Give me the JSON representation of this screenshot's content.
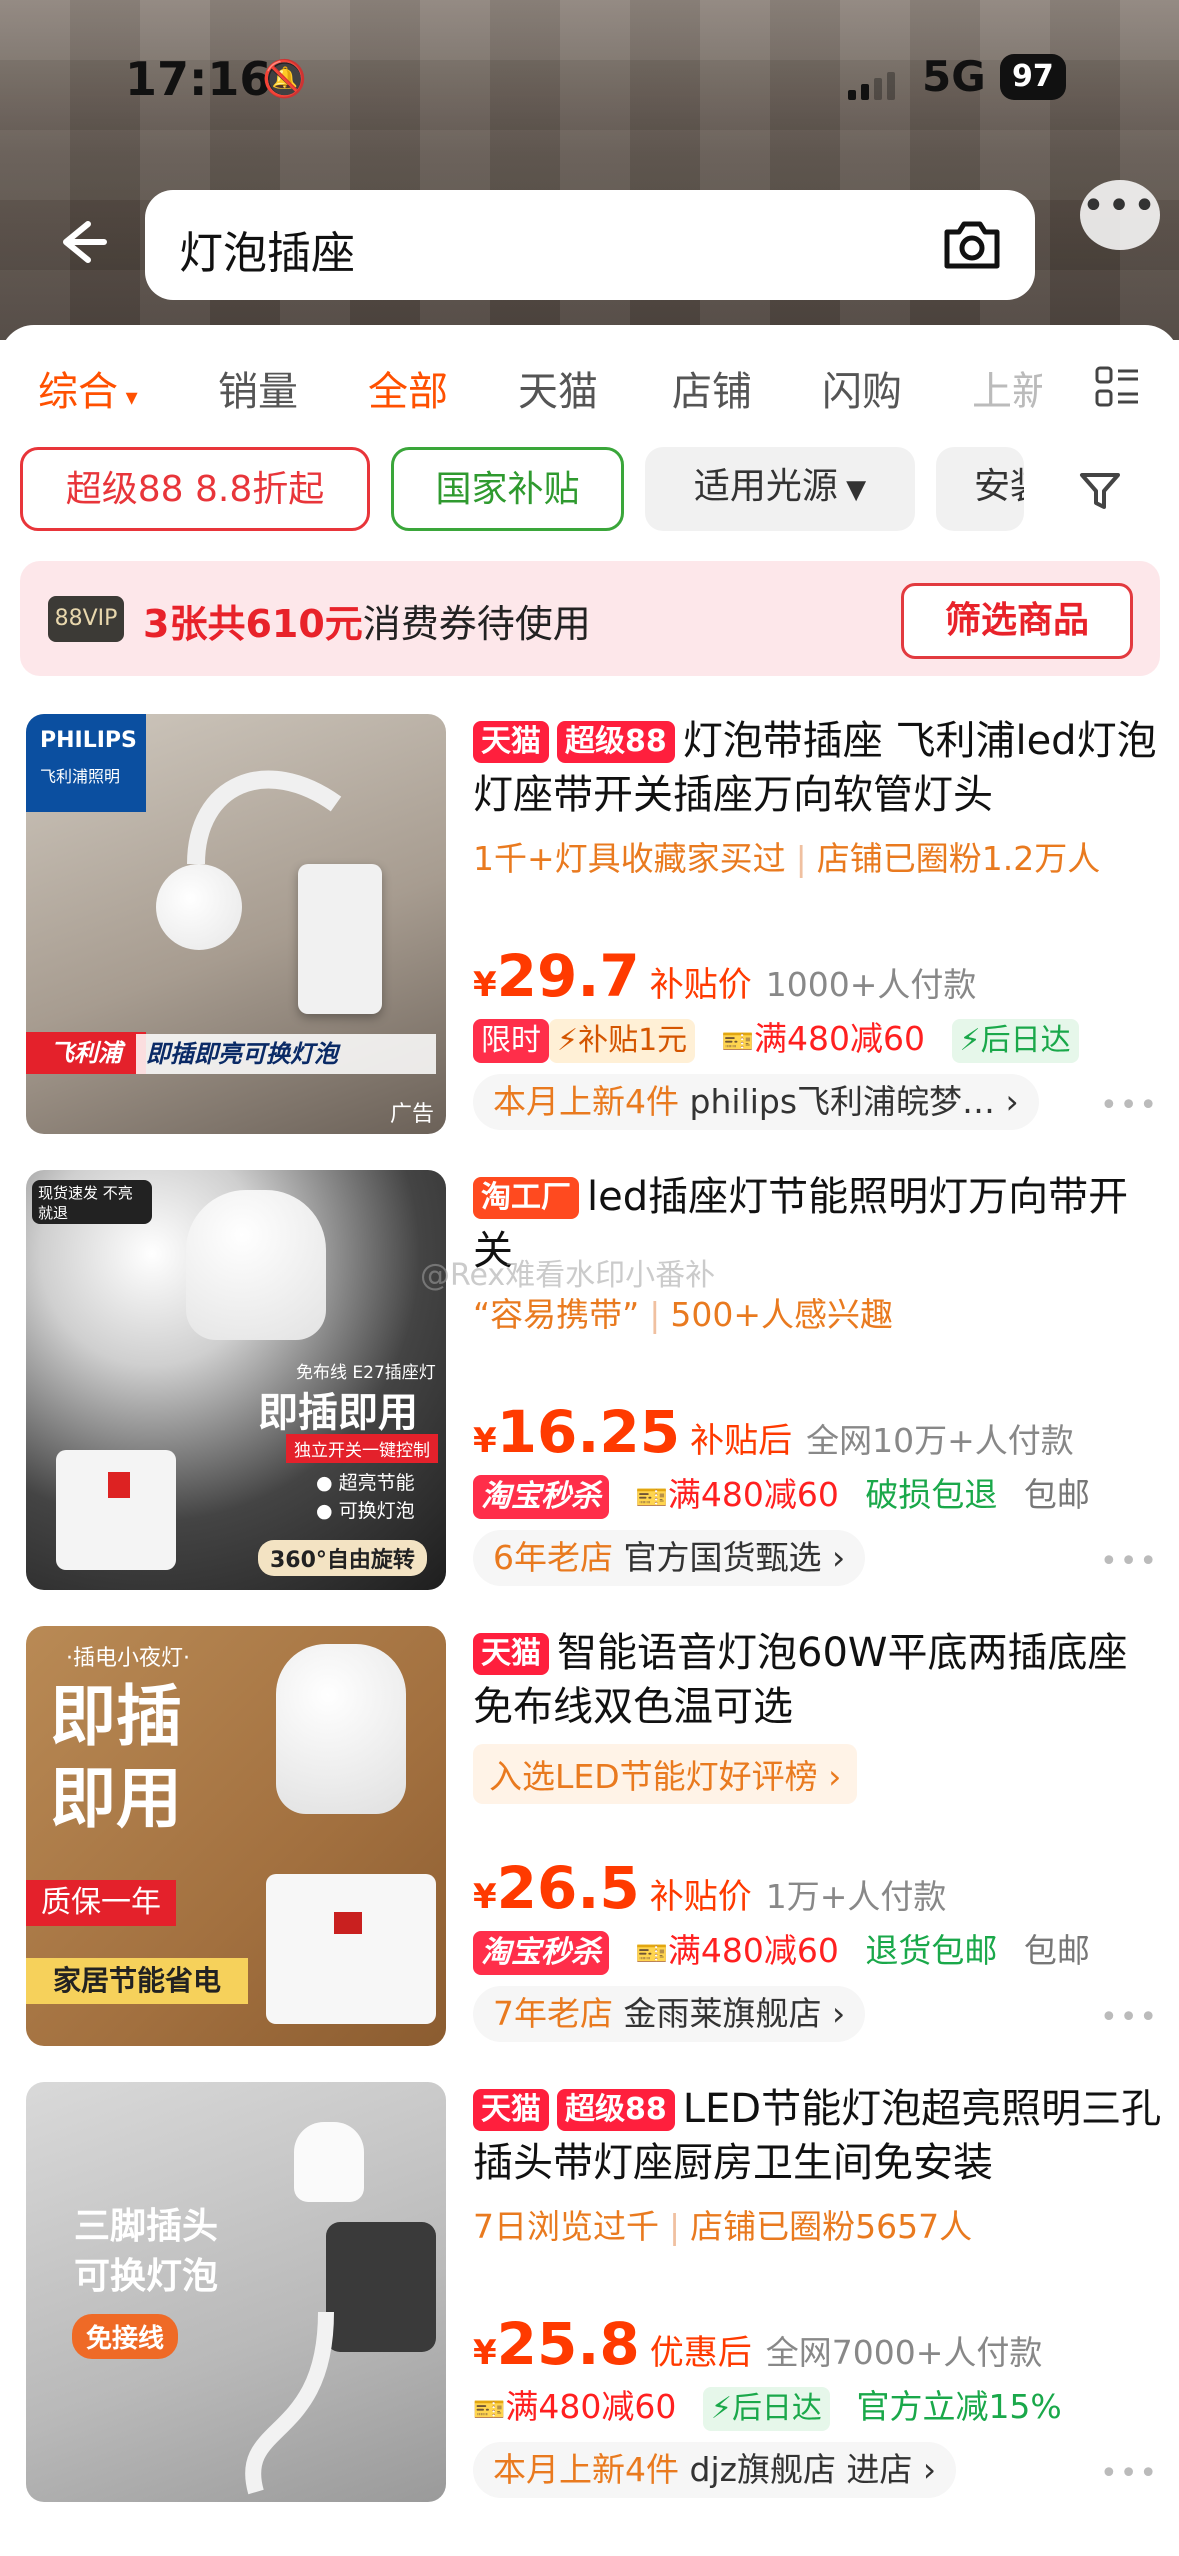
{
  "status_bar": {
    "time": "17:16",
    "network": "5G",
    "battery": "97"
  },
  "search": {
    "query": "灯泡插座",
    "more_dots": "•••"
  },
  "tabs": [
    {
      "label": "综合",
      "active": true
    },
    {
      "label": "销量",
      "active": false
    },
    {
      "label": "全部",
      "active": true
    },
    {
      "label": "天猫",
      "active": false
    },
    {
      "label": "店铺",
      "active": false
    },
    {
      "label": "闪购",
      "active": false
    },
    {
      "label": "上新",
      "active": false
    }
  ],
  "filters": {
    "chip1": "超级88 8.8折起",
    "chip2": "国家补贴",
    "chip3": "适用光源",
    "chip4": "安装"
  },
  "vip_banner": {
    "badge": "88VIP",
    "highlight": "3张共610元",
    "text": "消费券待使用",
    "button": "筛选商品"
  },
  "watermark": "@Rex难看水印小番补",
  "products": [
    {
      "tags": [
        "天猫",
        "超级88"
      ],
      "title": "灯泡带插座 飞利浦led灯泡灯座带开关插座万向软管灯头",
      "sub1": "1千+灯具收藏家买过",
      "sub2": "店铺已圈粉1.2万人",
      "currency": "¥",
      "price": "29.7",
      "price_label": "补贴价",
      "sales": "1000+人付款",
      "promo1": "限时",
      "promo1b": "补贴1元",
      "promo2": "满480减60",
      "promo3": "后日达",
      "shop_prefix": "本月上新4件",
      "shop": "philips飞利浦皖梦…",
      "img_brand": "PHILIPS",
      "img_brand_cn": "飞利浦照明",
      "img_slogan": "即插即亮可换灯泡",
      "img_tag": "飞利浦",
      "ad": "广告"
    },
    {
      "tags": [
        "淘工厂"
      ],
      "title": "led插座灯节能照明灯万向带开关",
      "sub1": "“容易携带”",
      "sub2": "500+人感兴趣",
      "currency": "¥",
      "price": "16.25",
      "price_label": "补贴后",
      "sales": "全网10万+人付款",
      "promo1": "淘宝秒杀",
      "promo2": "满480减60",
      "promo3": "破损包退",
      "promo4": "包邮",
      "shop_prefix": "6年老店",
      "shop": "官方国货甄选",
      "img_top": "现货速发 不亮就退",
      "img_main": "即插即用",
      "img_line": "独立开关一键控制",
      "img_b1": "超亮节能",
      "img_b2": "可换灯泡",
      "img_rot": "360°自由旋转",
      "img_small": "免布线 E27插座灯"
    },
    {
      "tags": [
        "天猫"
      ],
      "title": "智能语音灯泡60W平底两插底座 免布线双色温可选",
      "sub1": "入选LED节能灯好评榜",
      "currency": "¥",
      "price": "26.5",
      "price_label": "补贴价",
      "sales": "1万+人付款",
      "promo1": "淘宝秒杀",
      "promo2": "满480减60",
      "promo3": "退货包邮",
      "promo4": "包邮",
      "shop_prefix": "7年老店",
      "shop": "金雨莱旗舰店",
      "img_top": "·插电小夜灯·",
      "img_main1": "即插",
      "img_main2": "即用",
      "img_q": "质保一年",
      "img_s": "家居节能省电"
    },
    {
      "tags": [
        "天猫",
        "超级88"
      ],
      "title": "LED节能灯泡超亮照明三孔插头带灯座厨房卫生间免安装",
      "sub1": "7日浏览过千",
      "sub2": "店铺已圈粉5657人",
      "currency": "¥",
      "price": "25.8",
      "price_label": "优惠后",
      "sales": "全网7000+人付款",
      "promo1": "满480减60",
      "promo2": "后日达",
      "promo3": "官方立减15%",
      "shop_prefix": "本月上新4件",
      "shop": "djz旗舰店 进店",
      "img_main1": "三脚插头",
      "img_main2": "可换灯泡",
      "img_tag": "免接线"
    }
  ]
}
